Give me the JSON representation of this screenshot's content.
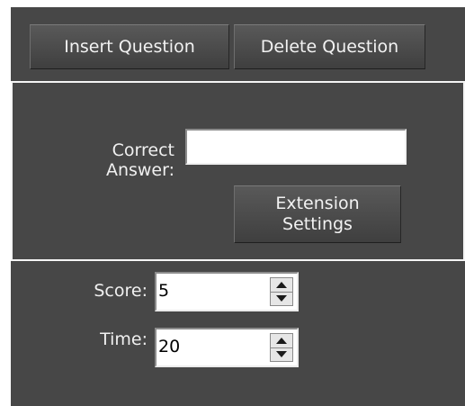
{
  "toolbar": {
    "insert_label": "Insert Question",
    "delete_label": "Delete Question"
  },
  "answer": {
    "label": "Correct\nAnswer:",
    "value": "",
    "extension_label": "Extension\nSettings"
  },
  "score": {
    "label": "Score:",
    "value": "5"
  },
  "time": {
    "label": "Time:",
    "value": "20"
  },
  "icons": {
    "spin_up": "triangle-up-icon",
    "spin_down": "triangle-down-icon"
  },
  "colors": {
    "panel_bg": "#474747",
    "border": "#f4f4f4",
    "text": "#f0f0f0"
  }
}
